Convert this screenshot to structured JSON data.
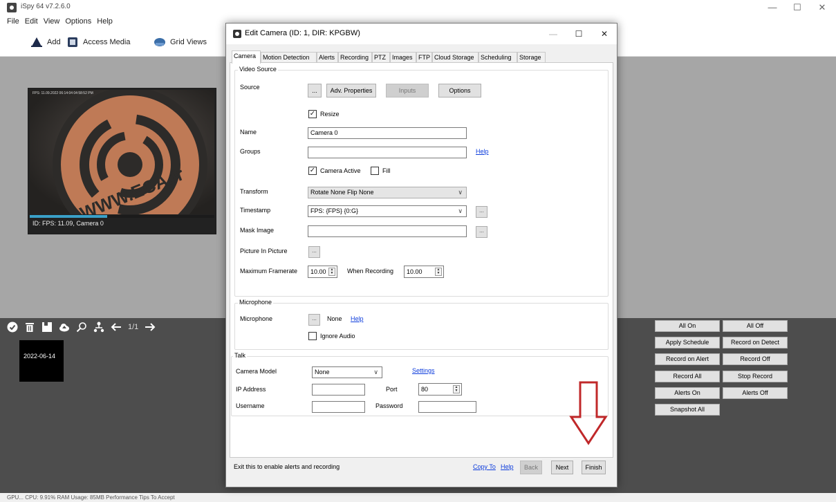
{
  "app": {
    "title": "iSpy 64 v7.2.6.0",
    "menu": [
      "File",
      "Edit",
      "View",
      "Options",
      "Help"
    ],
    "toolbar": {
      "add": "Add",
      "access_media": "Access Media",
      "grid_views": "Grid Views"
    },
    "window_controls": {
      "minimize": "—",
      "maximize": "☐",
      "close": "✕"
    }
  },
  "camera_tile": {
    "overlay_text": "FPS: 11.09.2022 06:14:04 04:58:52 PM",
    "caption": "ID: FPS: 11.09, Camera 0",
    "progress_percent": 42,
    "logo_text": "WWW.ECA.ir"
  },
  "bottom_bar": {
    "icons": [
      "check-circle-icon",
      "trash-icon",
      "save-icon",
      "cloud-upload-icon",
      "search-icon",
      "network-icon",
      "arrow-left-icon"
    ],
    "page_indicator": "1/1",
    "date": "2022-06-14"
  },
  "right_panel": {
    "buttons": [
      [
        "All On",
        "All Off"
      ],
      [
        "Apply Schedule",
        "Record on Detect"
      ],
      [
        "Record on Alert",
        "Record Off"
      ],
      [
        "Record All",
        "Stop Record"
      ],
      [
        "Alerts On",
        "Alerts Off"
      ],
      [
        "Snapshot All"
      ]
    ]
  },
  "status_bar": "GPU... CPU: 9.91% RAM Usage: 85MB Performance Tips To Accept",
  "dialog": {
    "title": "Edit Camera (ID: 1, DIR: KPGBW)",
    "controls": {
      "minimize": "—",
      "maximize": "☐",
      "close": "✕"
    },
    "tabs": [
      "Camera",
      "Motion Detection",
      "Alerts",
      "Recording",
      "PTZ",
      "Images",
      "FTP",
      "Cloud Storage",
      "Scheduling",
      "Storage"
    ],
    "active_tab": "Camera",
    "video_source": {
      "legend": "Video Source",
      "source_label": "Source",
      "browse": "...",
      "adv_properties": "Adv. Properties",
      "inputs": "Inputs",
      "options": "Options",
      "resize": {
        "label": "Resize",
        "checked": true
      },
      "name_label": "Name",
      "name_value": "Camera 0",
      "groups_label": "Groups",
      "groups_value": "",
      "groups_help": "Help",
      "camera_active": {
        "label": "Camera Active",
        "checked": true
      },
      "fill": {
        "label": "Fill",
        "checked": false
      },
      "transform_label": "Transform",
      "transform_value": "Rotate None Flip None",
      "timestamp_label": "Timestamp",
      "timestamp_value": "FPS: {FPS} {0:G}",
      "mask_label": "Mask Image",
      "mask_value": "",
      "pip_label": "Picture In Picture",
      "max_framerate_label": "Maximum Framerate",
      "max_framerate_value": "10.00",
      "when_recording_label": "When Recording",
      "when_recording_value": "10.00"
    },
    "microphone": {
      "legend": "Microphone",
      "label": "Microphone",
      "browse": "...",
      "value": "None",
      "help": "Help",
      "ignore_audio": {
        "label": "Ignore Audio",
        "checked": false
      }
    },
    "talk": {
      "legend": "Talk",
      "camera_model_label": "Camera Model",
      "camera_model_value": "None",
      "settings": "Settings",
      "ip_label": "IP Address",
      "ip_value": "",
      "port_label": "Port",
      "port_value": "80",
      "username_label": "Username",
      "username_value": "",
      "password_label": "Password",
      "password_value": ""
    },
    "footer": {
      "hint": "Exit this to enable alerts and recording",
      "copy_to": "Copy To",
      "help": "Help",
      "back": "Back",
      "next": "Next",
      "finish": "Finish"
    }
  },
  "colors": {
    "workspace": "#a6a6a6",
    "dark_panel": "#4d4d4d",
    "link": "#0b3bdc",
    "annotation": "#c0282a",
    "progress": "#3aa0c8"
  }
}
